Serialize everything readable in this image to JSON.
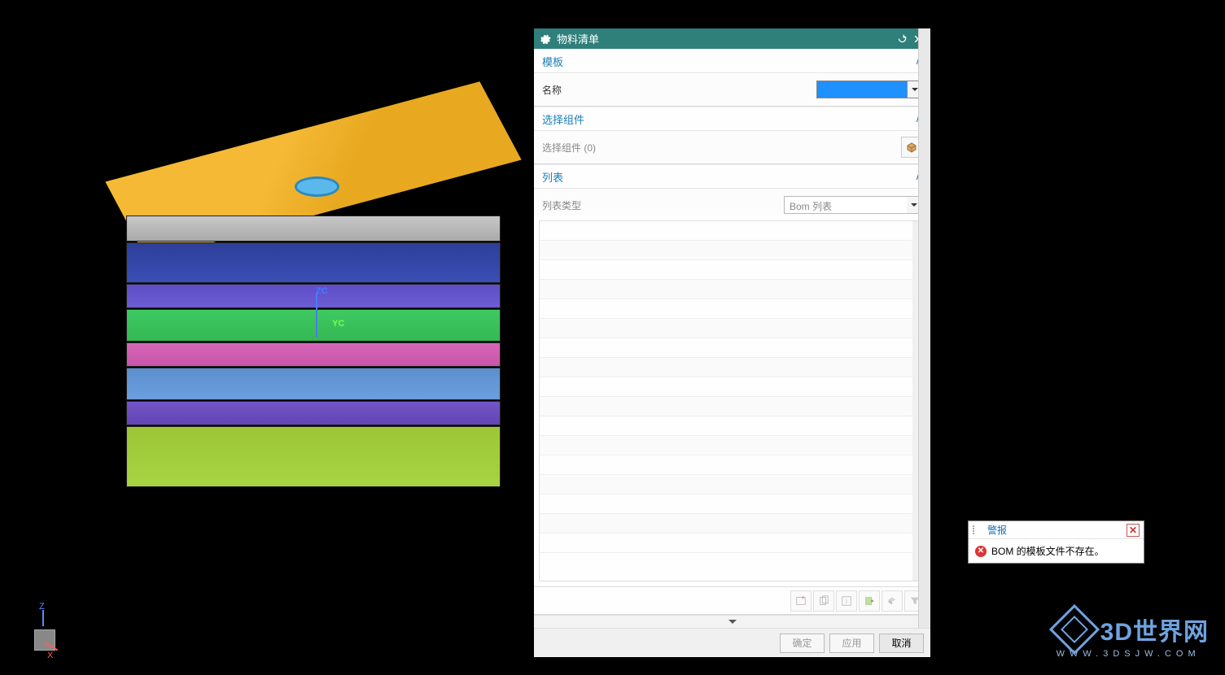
{
  "dialog": {
    "title": "物料清单",
    "sections": {
      "template": {
        "title": "模板",
        "name_label": "名称",
        "name_value": ""
      },
      "select_comp": {
        "title": "选择组件",
        "picker_label": "选择组件 (0)"
      },
      "list": {
        "title": "列表",
        "type_label": "列表类型",
        "type_value": "Bom 列表"
      }
    },
    "toolbar_icons": [
      "new-row-icon",
      "copy-icon",
      "info-icon",
      "export-icon",
      "view-icon",
      "filter-icon"
    ],
    "buttons": {
      "ok": "确定",
      "apply": "应用",
      "cancel": "取消"
    }
  },
  "alert": {
    "title": "警报",
    "message": "BOM 的模板文件不存在。"
  },
  "axes": {
    "zc": "ZC",
    "yc": "YC"
  },
  "csys": {
    "z": "Z",
    "x": "X"
  },
  "watermark": {
    "main": "3D世界网",
    "sub": "WWW.3DSJW.COM"
  }
}
